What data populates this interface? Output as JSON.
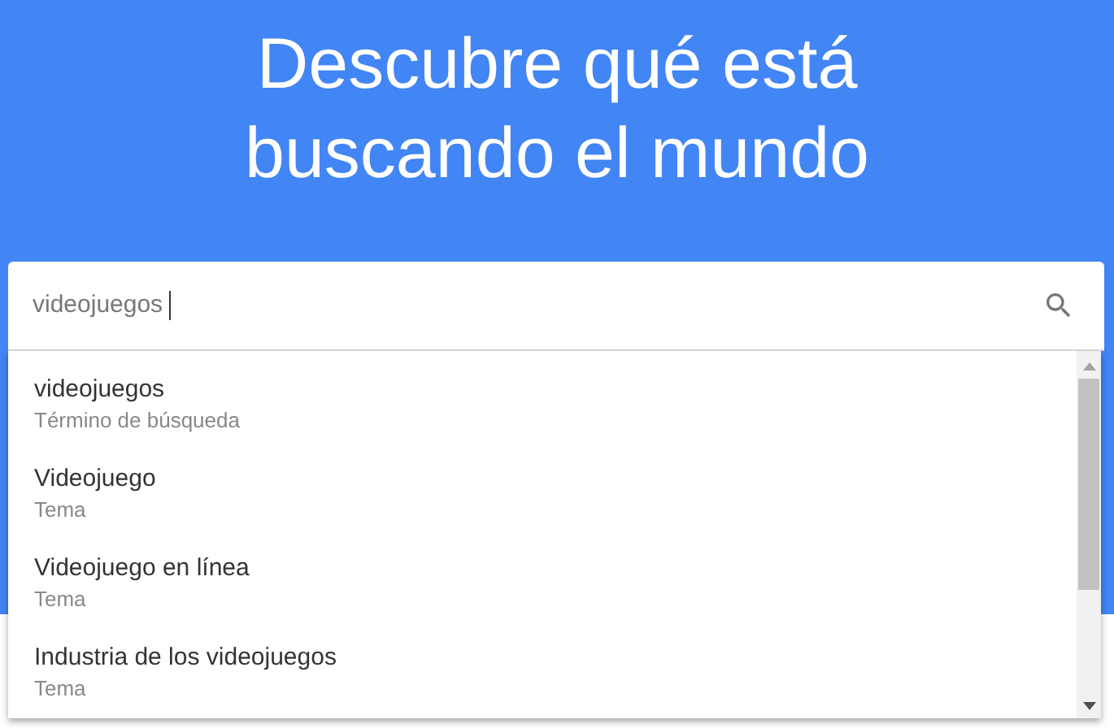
{
  "hero": {
    "title_lines": [
      "Descubre qué está",
      "buscando el mundo"
    ]
  },
  "search": {
    "value": "videojuegos"
  },
  "suggestions": [
    {
      "label": "videojuegos",
      "type": "Término de búsqueda"
    },
    {
      "label": "Videojuego",
      "type": "Tema"
    },
    {
      "label": "Videojuego en línea",
      "type": "Tema"
    },
    {
      "label": "Industria de los videojuegos",
      "type": "Tema"
    }
  ]
}
